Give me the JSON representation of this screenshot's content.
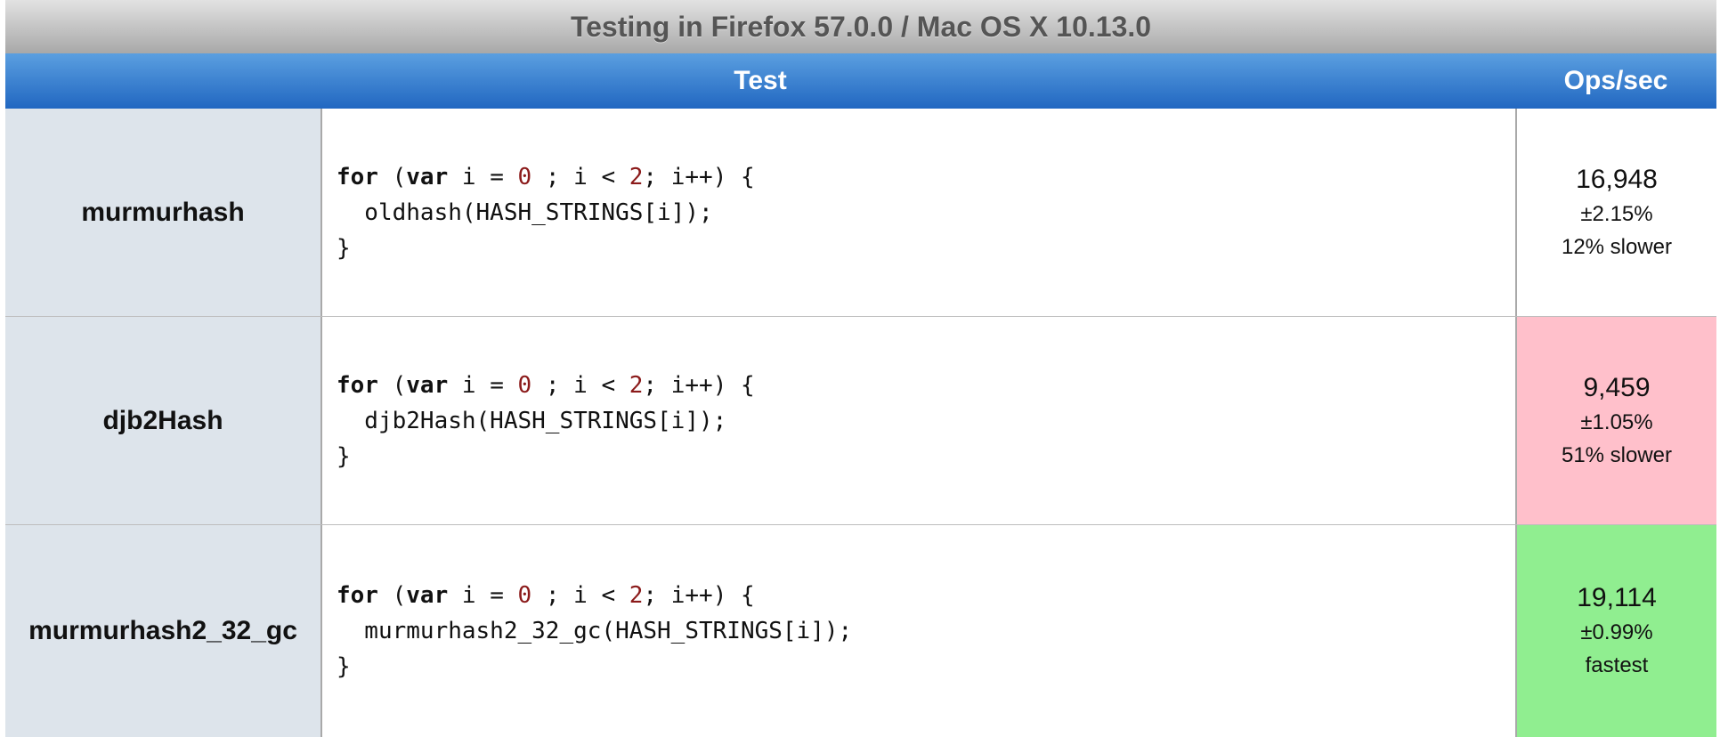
{
  "title": "Testing in Firefox 57.0.0 / Mac OS X 10.13.0",
  "header": {
    "test_label": "Test",
    "ops_label": "Ops/sec"
  },
  "rows": [
    {
      "name": "murmurhash",
      "code": {
        "for_kw": "for",
        "open_paren": " (",
        "var_kw": "var",
        "mid1": " i = ",
        "start": "0",
        "mid2": " ; i < ",
        "limit": "2",
        "tail": "; i++) {",
        "body": "  oldhash(HASH_STRINGS[i]);",
        "close": "}"
      },
      "ops": "16,948",
      "error": "±2.15%",
      "relative": "12% slower",
      "status_color": "#ffffff"
    },
    {
      "name": "djb2Hash",
      "code": {
        "for_kw": "for",
        "open_paren": " (",
        "var_kw": "var",
        "mid1": " i = ",
        "start": "0",
        "mid2": " ; i < ",
        "limit": "2",
        "tail": "; i++) {",
        "body": "  djb2Hash(HASH_STRINGS[i]);",
        "close": "}"
      },
      "ops": "9,459",
      "error": "±1.05%",
      "relative": "51% slower",
      "status_color": "#ffc0cb"
    },
    {
      "name": "murmurhash2_32_gc",
      "code": {
        "for_kw": "for",
        "open_paren": " (",
        "var_kw": "var",
        "mid1": " i = ",
        "start": "0",
        "mid2": " ; i < ",
        "limit": "2",
        "tail": "; i++) {",
        "body": "  murmurhash2_32_gc(HASH_STRINGS[i]);",
        "close": "}"
      },
      "ops": "19,114",
      "error": "±0.99%",
      "relative": "fastest",
      "status_color": "#90ee90"
    }
  ],
  "colors": {
    "header_blue": "#2f7bd0",
    "name_cell": "#dde4eb",
    "slower": "#ffc0cb",
    "fastest": "#90ee90",
    "number_literal": "#8b1a1a"
  }
}
